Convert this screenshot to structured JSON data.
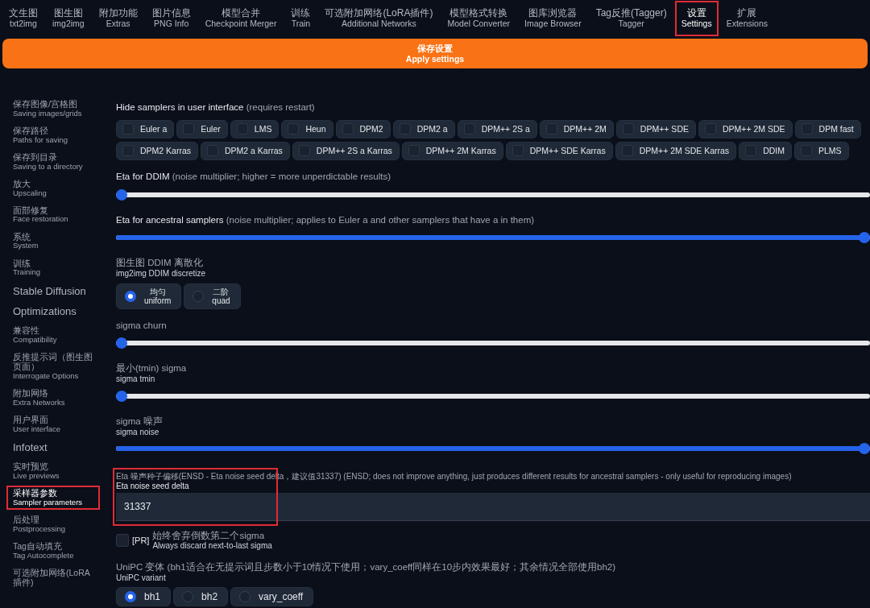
{
  "tabs": [
    {
      "zh": "文生图",
      "en": "txt2img",
      "selected": false,
      "highlighted": false
    },
    {
      "zh": "图生图",
      "en": "img2img",
      "selected": false,
      "highlighted": false
    },
    {
      "zh": "附加功能",
      "en": "Extras",
      "selected": false,
      "highlighted": false
    },
    {
      "zh": "图片信息",
      "en": "PNG Info",
      "selected": false,
      "highlighted": false
    },
    {
      "zh": "模型合并",
      "en": "Checkpoint Merger",
      "selected": false,
      "highlighted": false
    },
    {
      "zh": "训练",
      "en": "Train",
      "selected": false,
      "highlighted": false
    },
    {
      "zh": "可选附加网络(LoRA插件)",
      "en": "Additional Networks",
      "selected": false,
      "highlighted": false
    },
    {
      "zh": "模型格式转换",
      "en": "Model Converter",
      "selected": false,
      "highlighted": false
    },
    {
      "zh": "图库浏览器",
      "en": "Image Browser",
      "selected": false,
      "highlighted": false
    },
    {
      "zh": "Tag反推(Tagger)",
      "en": "Tagger",
      "selected": false,
      "highlighted": false
    },
    {
      "zh": "设置",
      "en": "Settings",
      "selected": true,
      "highlighted": true
    },
    {
      "zh": "扩展",
      "en": "Extensions",
      "selected": false,
      "highlighted": false
    }
  ],
  "apply_button": {
    "zh": "保存设置",
    "en": "Apply settings"
  },
  "sidebar": {
    "items": [
      {
        "zh": "保存图像/宫格图",
        "en": "Saving images/grids",
        "selected": false,
        "highlighted": false
      },
      {
        "zh": "保存路径",
        "en": "Paths for saving",
        "selected": false,
        "highlighted": false
      },
      {
        "zh": "保存到目录",
        "en": "Saving to a directory",
        "selected": false,
        "highlighted": false
      },
      {
        "zh": "放大",
        "en": "Upscaling",
        "selected": false,
        "highlighted": false
      },
      {
        "zh": "面部修复",
        "en": "Face restoration",
        "selected": false,
        "highlighted": false
      },
      {
        "zh": "系统",
        "en": "System",
        "selected": false,
        "highlighted": false
      },
      {
        "zh": "训练",
        "en": "Training",
        "selected": false,
        "highlighted": false
      },
      {
        "en": "Stable Diffusion",
        "selected": false,
        "highlighted": false
      },
      {
        "en": "Optimizations",
        "selected": false,
        "highlighted": false
      },
      {
        "zh": "兼容性",
        "en": "Compatibility",
        "selected": false,
        "highlighted": false
      },
      {
        "zh": "反推提示词（图生图页面）",
        "en": "Interrogate Options",
        "selected": false,
        "highlighted": false
      },
      {
        "zh": "附加网络",
        "en": "Extra Networks",
        "selected": false,
        "highlighted": false
      },
      {
        "zh": "用户界面",
        "en": "User interface",
        "selected": false,
        "highlighted": false
      },
      {
        "en": "Infotext",
        "selected": false,
        "highlighted": false
      },
      {
        "zh": "实时预览",
        "en": "Live previews",
        "selected": false,
        "highlighted": false
      },
      {
        "zh": "采样器参数",
        "en": "Sampler parameters",
        "selected": true,
        "highlighted": true
      },
      {
        "zh": "后处理",
        "en": "Postprocessing",
        "selected": false,
        "highlighted": false
      },
      {
        "zh": "Tag自动填充",
        "en": "Tag Autocomplete",
        "selected": false,
        "highlighted": false
      },
      {
        "zh": "可选附加网络(LoRA插件)",
        "selected": false,
        "highlighted": false
      }
    ]
  },
  "settings": [
    {
      "kind": "checkgroup",
      "label": "**Hide samplers in user interface** (requires restart)",
      "options": [
        {
          "label": "Euler a",
          "checked": false
        },
        {
          "label": "Euler",
          "checked": false
        },
        {
          "label": "LMS",
          "checked": false
        },
        {
          "label": "Heun",
          "checked": false
        },
        {
          "label": "DPM2",
          "checked": false
        },
        {
          "label": "DPM2 a",
          "checked": false
        },
        {
          "label": "DPM++ 2S a",
          "checked": false
        },
        {
          "label": "DPM++ 2M",
          "checked": false
        },
        {
          "label": "DPM++ SDE",
          "checked": false
        },
        {
          "label": "DPM++ 2M SDE",
          "checked": false
        },
        {
          "label": "DPM fast",
          "checked": false
        },
        {
          "label": "DPM2 Karras",
          "checked": false
        },
        {
          "label": "DPM2 a Karras",
          "checked": false
        },
        {
          "label": "DPM++ 2S a Karras",
          "checked": false
        },
        {
          "label": "DPM++ 2M Karras",
          "checked": false
        },
        {
          "label": "DPM++ SDE Karras",
          "checked": false
        },
        {
          "label": "DPM++ 2M SDE Karras",
          "checked": false
        },
        {
          "label": "DDIM",
          "checked": false
        },
        {
          "label": "PLMS",
          "checked": false
        }
      ]
    },
    {
      "kind": "slider",
      "label": "**Eta for DDIM** (noise multiplier; higher = more unperdictable results)",
      "level": 0
    },
    {
      "kind": "slider",
      "label": "**Eta for ancestral samplers** (noise multiplier; applies to Euler a and other samplers that have a in them)",
      "level": 1
    },
    {
      "kind": "radio",
      "label": "图生图 DDIM 离散化",
      "sublabel": "img2img DDIM discretize",
      "options": [
        {
          "zh": "均匀",
          "en": "uniform",
          "selected": true
        },
        {
          "zh": "二阶",
          "en": "quad",
          "selected": false
        }
      ]
    },
    {
      "kind": "slider",
      "label": "sigma churn",
      "level": 0
    },
    {
      "kind": "slider",
      "label": "最小(tmin) sigma",
      "sublabel": "sigma tmin",
      "level": 0
    },
    {
      "kind": "slider",
      "label": "sigma 噪声",
      "sublabel": "sigma noise",
      "level": 1
    },
    {
      "kind": "number",
      "label": "Eta 噪声种子偏移(ENSD - Eta noise seed delta，建议值31337) (ENSD; does not improve anything, just produces different results for ancestral samplers - only useful for reproducing images)",
      "sublabel": "Eta noise seed delta",
      "value": "31337",
      "highlighted": true
    },
    {
      "kind": "checkbox",
      "tag": "[PR]",
      "label": "始终舍弃倒数第二个sigma",
      "sublabel": "Always discard next-to-last sigma",
      "checked": false
    },
    {
      "kind": "radio",
      "label": "UniPC 变体 (bh1适合在无提示词且步数小于10情况下使用；vary_coeff同样在10步内效果最好；其余情况全部使用bh2)",
      "sublabel": "UniPC variant",
      "options": [
        {
          "en": "bh1",
          "selected": true
        },
        {
          "en": "bh2",
          "selected": false
        },
        {
          "en": "vary_coeff",
          "selected": false
        }
      ]
    }
  ]
}
